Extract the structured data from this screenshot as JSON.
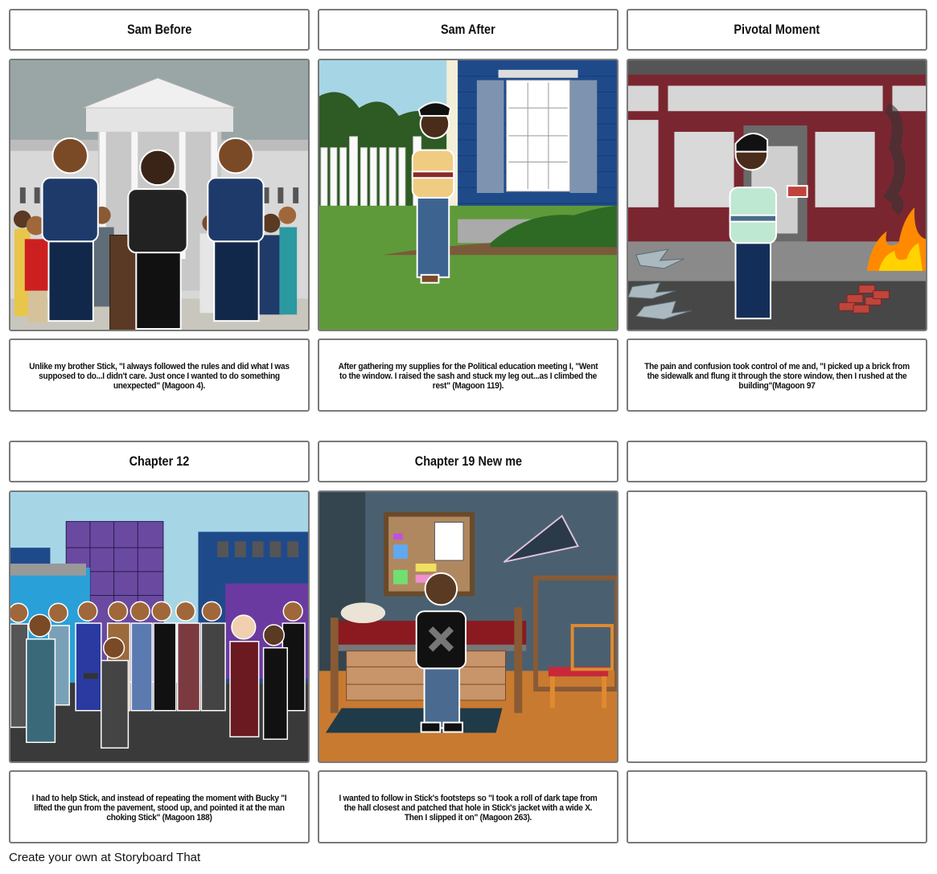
{
  "storyboard": {
    "row1": [
      {
        "title": "Sam Before",
        "scene": "group of people gathered in front of a white columned government building, a speaker at a podium",
        "description": "Unlike my brother Stick, \"I always followed the rules and did what I was supposed to do...I didn't care. Just once I wanted to do something unexpected\" (Magoon 4)."
      },
      {
        "title": "Sam After",
        "scene": "young man in a sweater stepping out beside a blue house with a window and white picket fence",
        "description": "After gathering my supplies for the Political education meeting I, \"Went to the window. I raised the sash and stuck my leg out...as I climbed the rest\" (Magoon 119)."
      },
      {
        "title": "Pivotal Moment",
        "scene": "young man holding a brick in front of a red storefront with broken glass, bricks and fire",
        "description": "The pain and confusion took control of me and, \"I picked up a brick from the sidewalk and flung it through the store window, then I rushed at the building\"(Magoon 97"
      }
    ],
    "row2": [
      {
        "title": "Chapter 12",
        "scene": "crowd of people on a city street with buildings, one person holding a gun",
        "description": "I had to help Stick, and instead of repeating the moment with Bucky \"I lifted the gun from the pavement, stood up, and pointed it at the man choking Stick\" (Magoon 188)"
      },
      {
        "title": "Chapter 19 New me",
        "scene": "young man wearing a black jacket with a taped X standing in a bedroom",
        "description": "I wanted to follow in Stick's footsteps so \"I took a roll of dark tape from the hall closest and patched that hole in Stick's jacket with a wide X. Then I slipped it on\" (Magoon 263)."
      },
      {
        "title": "",
        "scene": "",
        "description": ""
      }
    ]
  },
  "footer": {
    "text": "Create your own at Storyboard That"
  }
}
